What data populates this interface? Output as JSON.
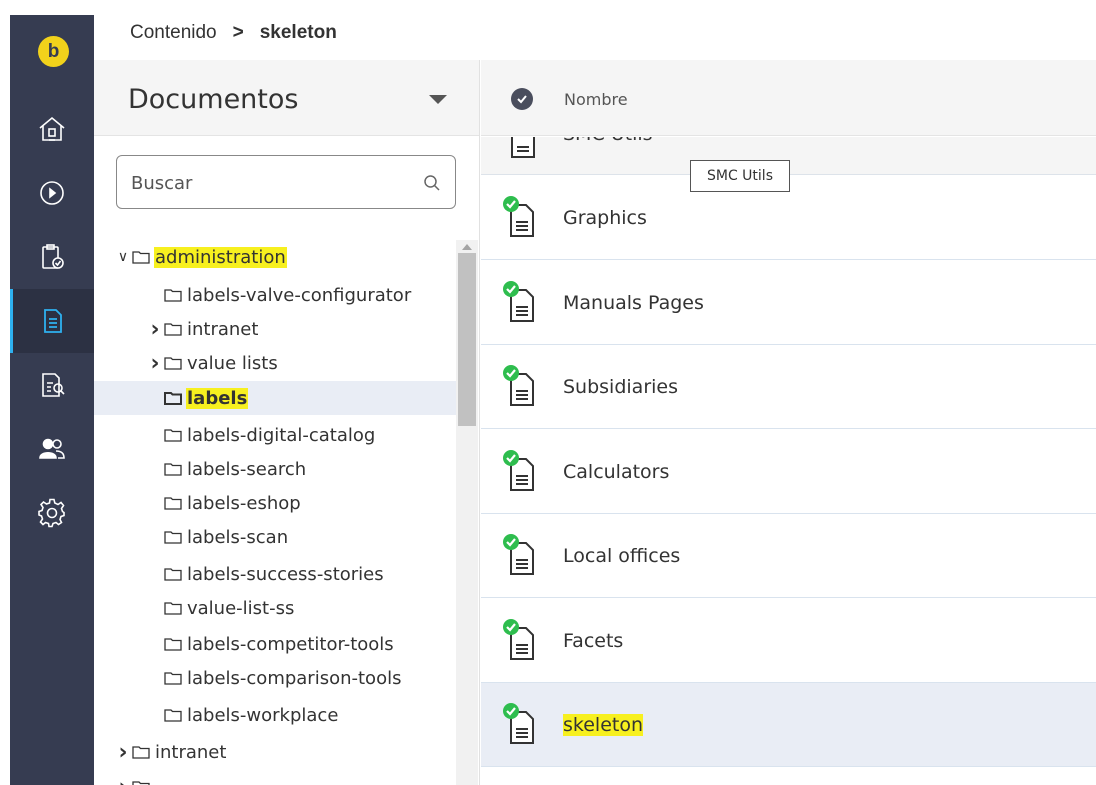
{
  "rail": {
    "logo_letter": "b",
    "accent_color": "#2eb1f0",
    "items": [
      {
        "icon": "home-icon"
      },
      {
        "icon": "play-circle-icon"
      },
      {
        "icon": "clipboard-check-icon"
      },
      {
        "icon": "document-icon",
        "active": true
      },
      {
        "icon": "document-search-icon"
      },
      {
        "icon": "users-icon"
      },
      {
        "icon": "gear-icon"
      }
    ]
  },
  "breadcrumb": {
    "root": "Contenido",
    "separator": ">",
    "current": "skeleton"
  },
  "tree_panel": {
    "title": "Documentos",
    "search_placeholder": "Buscar",
    "rows": [
      {
        "label": "administration",
        "level": 0,
        "chevron": "down",
        "highlight": true
      },
      {
        "label": "labels-valve-configurator",
        "level": 1,
        "chevron": ""
      },
      {
        "label": "intranet",
        "level": 1,
        "chevron": "right"
      },
      {
        "label": "value lists",
        "level": 1,
        "chevron": "right"
      },
      {
        "label": "labels",
        "level": 1,
        "chevron": "",
        "highlight": true,
        "selected": true
      },
      {
        "label": "labels-digital-catalog",
        "level": 1,
        "chevron": ""
      },
      {
        "label": "labels-search",
        "level": 1,
        "chevron": ""
      },
      {
        "label": "labels-eshop",
        "level": 1,
        "chevron": ""
      },
      {
        "label": "labels-scan",
        "level": 1,
        "chevron": ""
      },
      {
        "label": "labels-success-stories",
        "level": 1,
        "chevron": ""
      },
      {
        "label": "value-list-ss",
        "level": 1,
        "chevron": ""
      },
      {
        "label": "labels-competitor-tools",
        "level": 1,
        "chevron": ""
      },
      {
        "label": "labels-comparison-tools",
        "level": 1,
        "chevron": ""
      },
      {
        "label": "labels-workplace",
        "level": 1,
        "chevron": ""
      },
      {
        "label": "intranet",
        "level": 0,
        "chevron": "right"
      },
      {
        "label": "",
        "level": 0,
        "chevron": "right"
      }
    ]
  },
  "list_panel": {
    "column_name": "Nombre",
    "partial_row": "SMC Utils",
    "tooltip": "SMC Utils",
    "rows": [
      {
        "name": "Graphics"
      },
      {
        "name": "Manuals Pages"
      },
      {
        "name": "Subsidiaries"
      },
      {
        "name": "Calculators"
      },
      {
        "name": "Local offices"
      },
      {
        "name": "Facets"
      },
      {
        "name": "skeleton",
        "active": true,
        "highlight": true
      }
    ]
  },
  "colors": {
    "rail_bg": "#363c51",
    "logo": "#f2d21b",
    "highlight": "#f7f01f",
    "status_ok": "#2ebd4e",
    "selected_row": "#e9edf5"
  }
}
